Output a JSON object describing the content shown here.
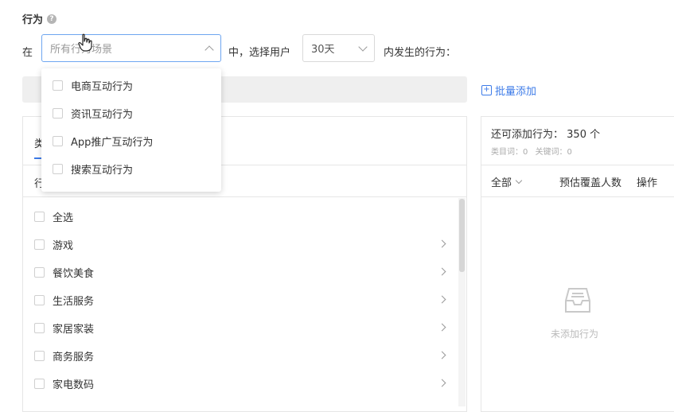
{
  "section_title": "行为",
  "prefix_label": "在",
  "scene_select": {
    "placeholder": "所有行为场景"
  },
  "mid_label": "中，选择用户",
  "days_select": {
    "value": "30天"
  },
  "suffix_label": "内发生的行为：",
  "batch_add_label": "批量添加",
  "dropdown_options": [
    {
      "label": "电商互动行为"
    },
    {
      "label": "资讯互动行为"
    },
    {
      "label": "App推广互动行为"
    },
    {
      "label": "搜索互动行为"
    }
  ],
  "left_panel": {
    "tab_partial": "类",
    "header_partial": "行",
    "select_all_label": "全选",
    "categories": [
      {
        "label": "游戏"
      },
      {
        "label": "餐饮美食"
      },
      {
        "label": "生活服务"
      },
      {
        "label": "家居家装"
      },
      {
        "label": "商务服务"
      },
      {
        "label": "家电数码"
      }
    ]
  },
  "right_panel": {
    "remaining_label": "还可添加行为：",
    "remaining_value": "350 个",
    "category_words": "类目词：0",
    "keywords": "关键词：0",
    "filter_label": "全部",
    "col_coverage": "预估覆盖人数",
    "col_action": "操作",
    "empty_text": "未添加行为"
  },
  "colors": {
    "accent": "#3d7be8",
    "focus_border": "#6ea6f0"
  }
}
